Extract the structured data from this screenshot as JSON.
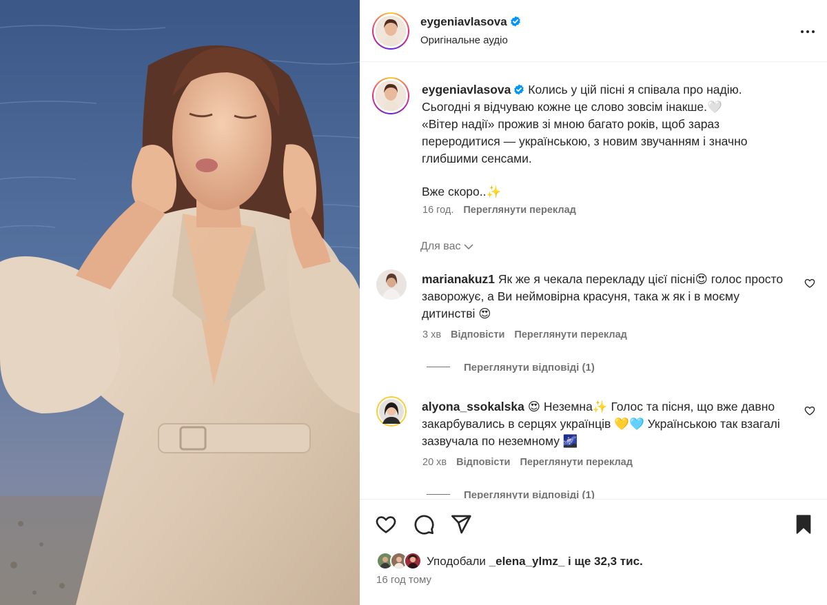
{
  "post": {
    "username": "eygeniavlasova",
    "audio_label": "Оригінальне аудіо",
    "verified": true
  },
  "caption": {
    "username": "eygeniavlasova",
    "line1": "Колись у цій пісні я співала про надію.",
    "line2": "Сьогодні я відчуваю кожне це слово зовсім інакше.🤍",
    "line3": "«Вітер надії» прожив зі мною багато років, щоб зараз",
    "line4": "переродитися — українською, з новим звучанням і значно",
    "line5": "глибшими сенсами.",
    "line6": "Вже скоро..✨",
    "time": "16 год.",
    "translate": "Переглянути переклад"
  },
  "for_you": "Для вас",
  "comments": [
    {
      "username": "marianakuz1",
      "text": "Як же я чекала перекладу цієї пісні😍 голос просто заворожує, а Ви неймовірна красуня, така ж як і в моєму дитинстві 😍",
      "time": "3 хв",
      "reply": "Відповісти",
      "translate": "Переглянути переклад",
      "view_replies": "Переглянути відповіді (1)"
    },
    {
      "username": "alyona_ssokalska",
      "text": "😍 Неземна✨ Голос та пісня, що вже давно закарбувались в серцях українців 💛🩵 Українською так взагалі зазвучала по неземному 🌌",
      "time": "20 хв",
      "reply": "Відповісти",
      "translate": "Переглянути переклад",
      "view_replies": "Переглянути відповіді (1)"
    }
  ],
  "likes": {
    "prefix": "Уподобали",
    "user": "_elena_ylmz_",
    "suffix": "і ще 32,3 тис."
  },
  "posted_ago": "16 год тому",
  "icons": [
    "heart-icon",
    "comment-icon",
    "share-icon",
    "bookmark-icon",
    "more-icon",
    "verified-icon",
    "chevron-down-icon"
  ],
  "colors": {
    "verified": "#0095f6",
    "text": "#262626",
    "secondary": "#737373"
  }
}
